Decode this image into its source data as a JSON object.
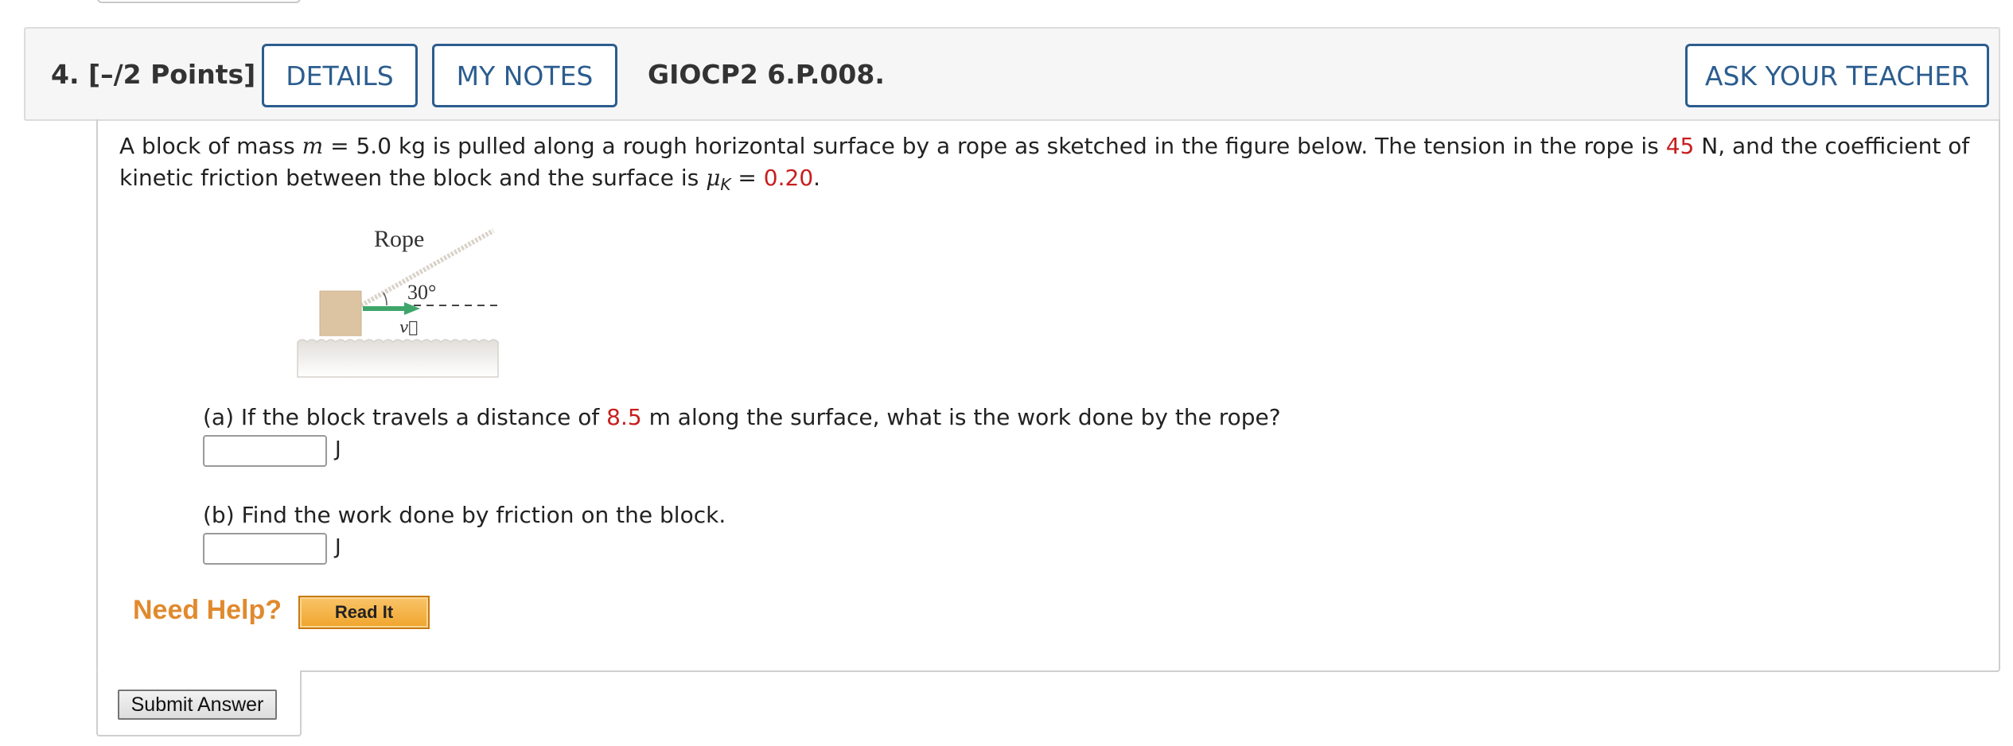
{
  "question": {
    "number_points": "4.  [–/2 Points]",
    "details_label": "DETAILS",
    "my_notes_label": "MY NOTES",
    "code": "GIOCP2 6.P.008.",
    "ask_teacher_label": "ASK YOUR TEACHER"
  },
  "prompt": {
    "text_1": "A block of mass ",
    "mass_symbol": "m",
    "text_2": " = 5.0 kg  is pulled along a rough horizontal surface by a rope as sketched in the figure below. The tension in the rope is ",
    "tension_value": "45",
    "text_3": " N, and the coefficient of kinetic friction between the block and the surface is ",
    "mu_symbol": "μ",
    "mu_subscript": "K",
    "text_4": " = ",
    "mu_value": "0.20",
    "text_5": "."
  },
  "figure": {
    "rope_label": "Rope",
    "angle_label": "30°",
    "velocity_label": "v⃗",
    "colors": {
      "block": "#dcc4a3",
      "arrow": "#3fa66a",
      "rope": "#d8d2c8",
      "ground": "#e4e1dc"
    }
  },
  "parts": {
    "a": {
      "text_1": "(a) If the block travels a distance of ",
      "distance_value": "8.5",
      "text_2": " m along the surface, what is the work done by the rope?",
      "unit": "J",
      "value": ""
    },
    "b": {
      "text": "(b) Find the work done by friction on the block.",
      "unit": "J",
      "value": ""
    }
  },
  "help": {
    "need_help_label": "Need Help?",
    "read_it_label": "Read It"
  },
  "submit": {
    "label": "Submit Answer"
  }
}
